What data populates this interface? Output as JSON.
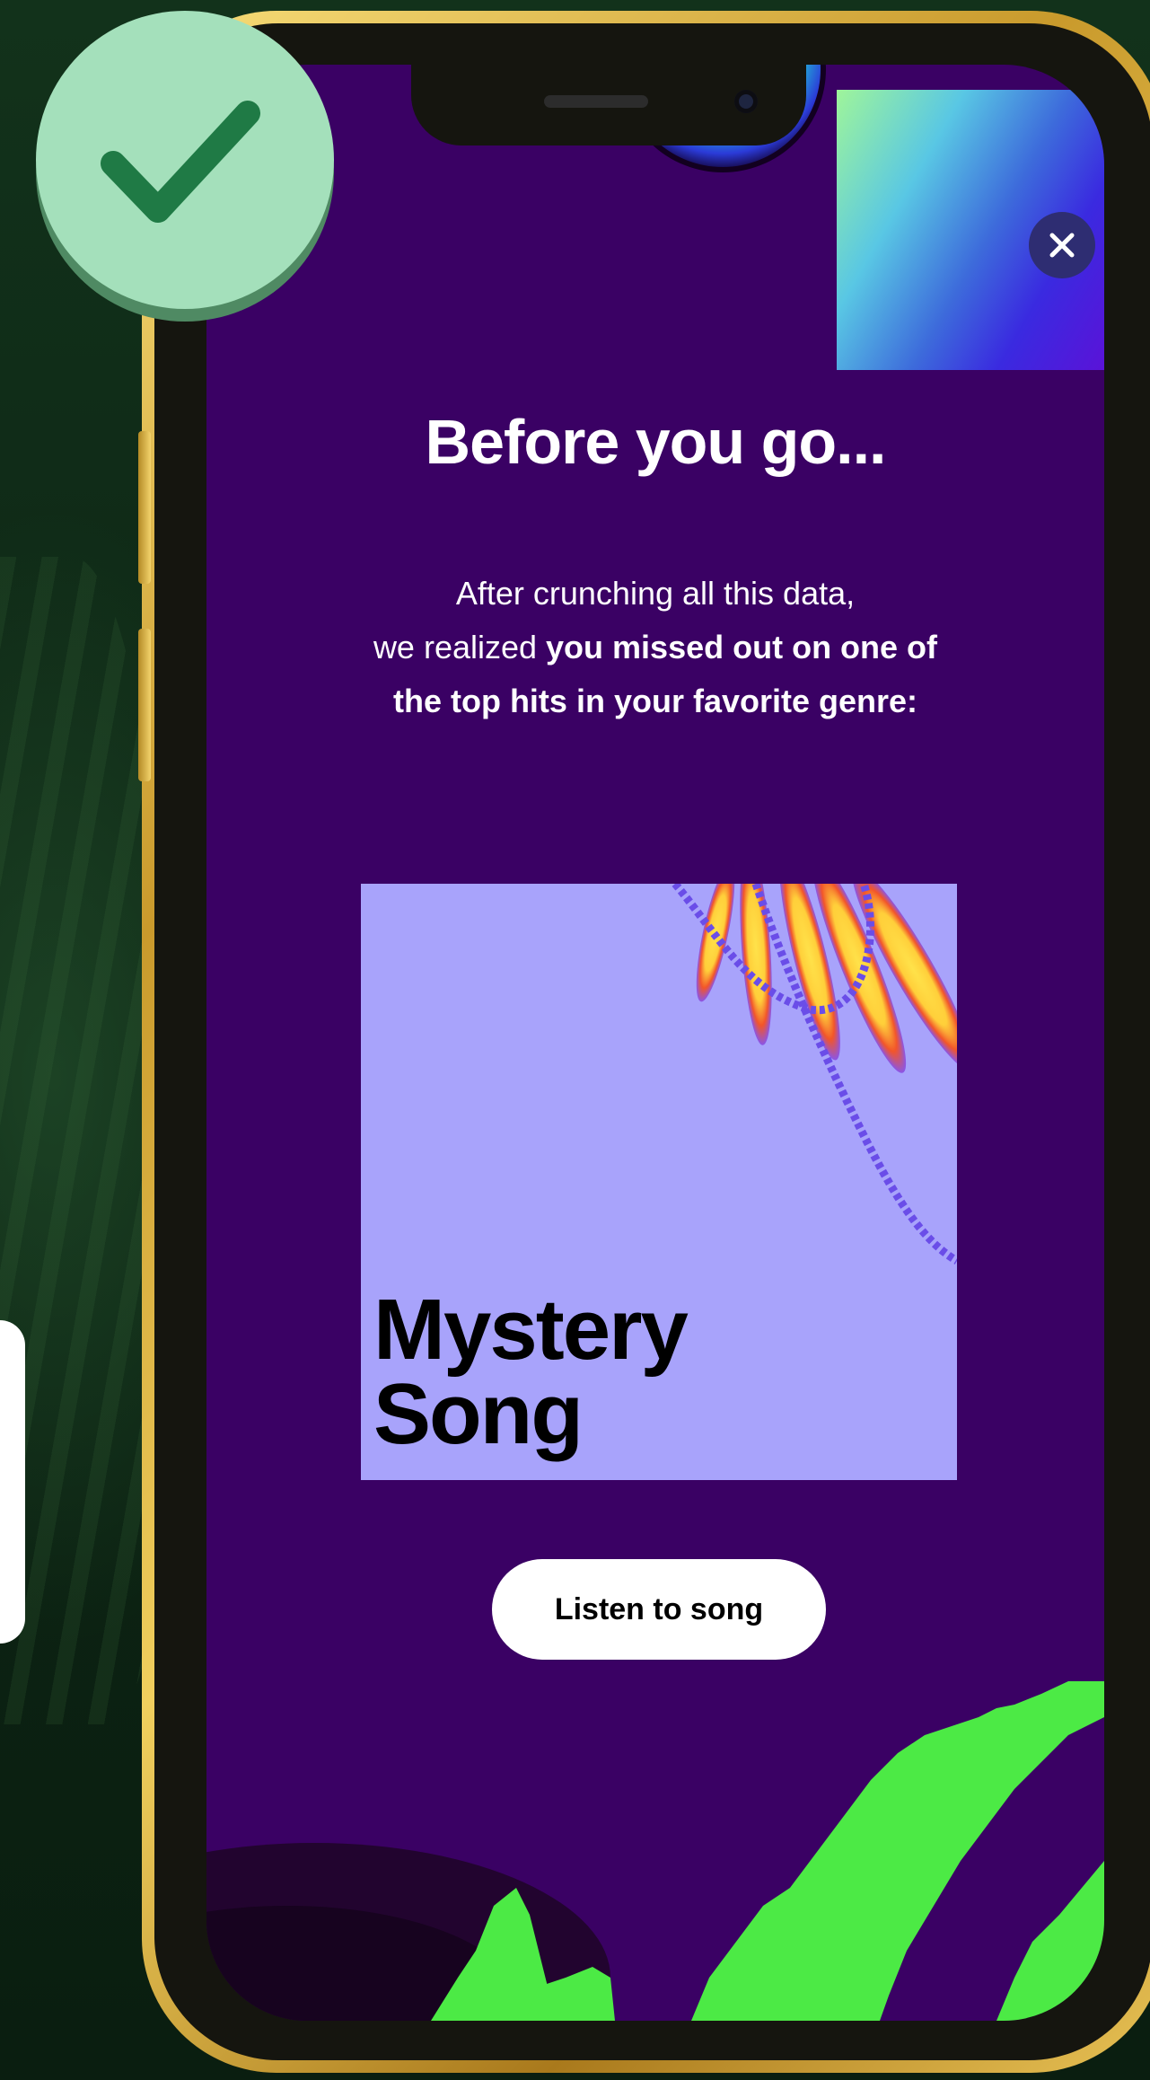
{
  "modal": {
    "title": "Before you go...",
    "intro_line1": "After crunching all this data,",
    "intro_line2_plain": "we realized ",
    "intro_line2_bold": "you missed out on one of",
    "intro_line3_bold": "the top hits in your favorite genre:",
    "close_label": "×"
  },
  "song_card": {
    "title_line1": "Mystery",
    "title_line2": "Song"
  },
  "actions": {
    "listen_label": "Listen to song"
  },
  "colors": {
    "screen_background": "#3a0164",
    "cover_background": "#a8a3fb",
    "badge_green": "#a4e0bb",
    "checkmark": "#1f7a45",
    "bottom_shapes": "#4cea45"
  },
  "icons": {
    "badge": "checkmark-icon",
    "close": "close-icon"
  }
}
